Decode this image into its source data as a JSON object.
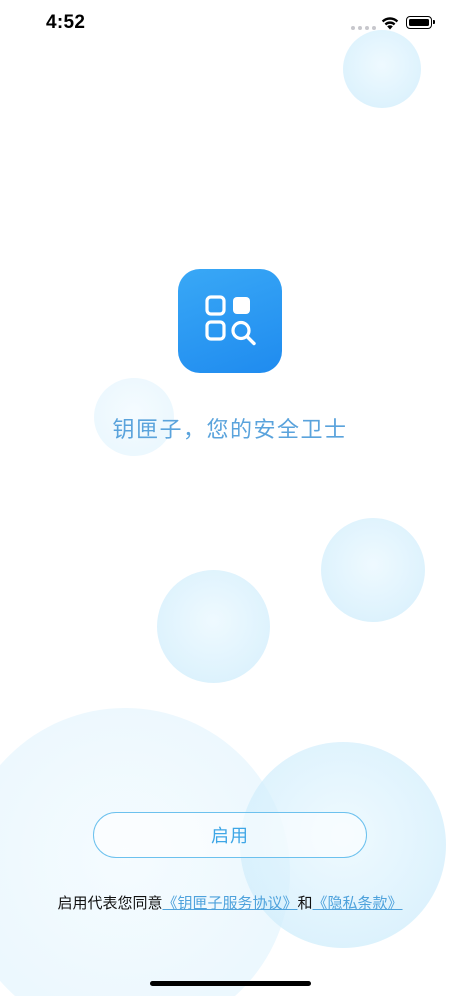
{
  "status_bar": {
    "time": "4:52"
  },
  "brand": {
    "icon_name": "app-grid-search-icon",
    "accent_color": "#2196f3"
  },
  "slogan": "钥匣子，您的安全卫士",
  "enable_button_label": "启用",
  "agreement": {
    "prefix": "启用代表您同意",
    "service_link": "《钥匣子服务协议》",
    "conjunction": "和",
    "privacy_link": "《隐私条款》"
  }
}
